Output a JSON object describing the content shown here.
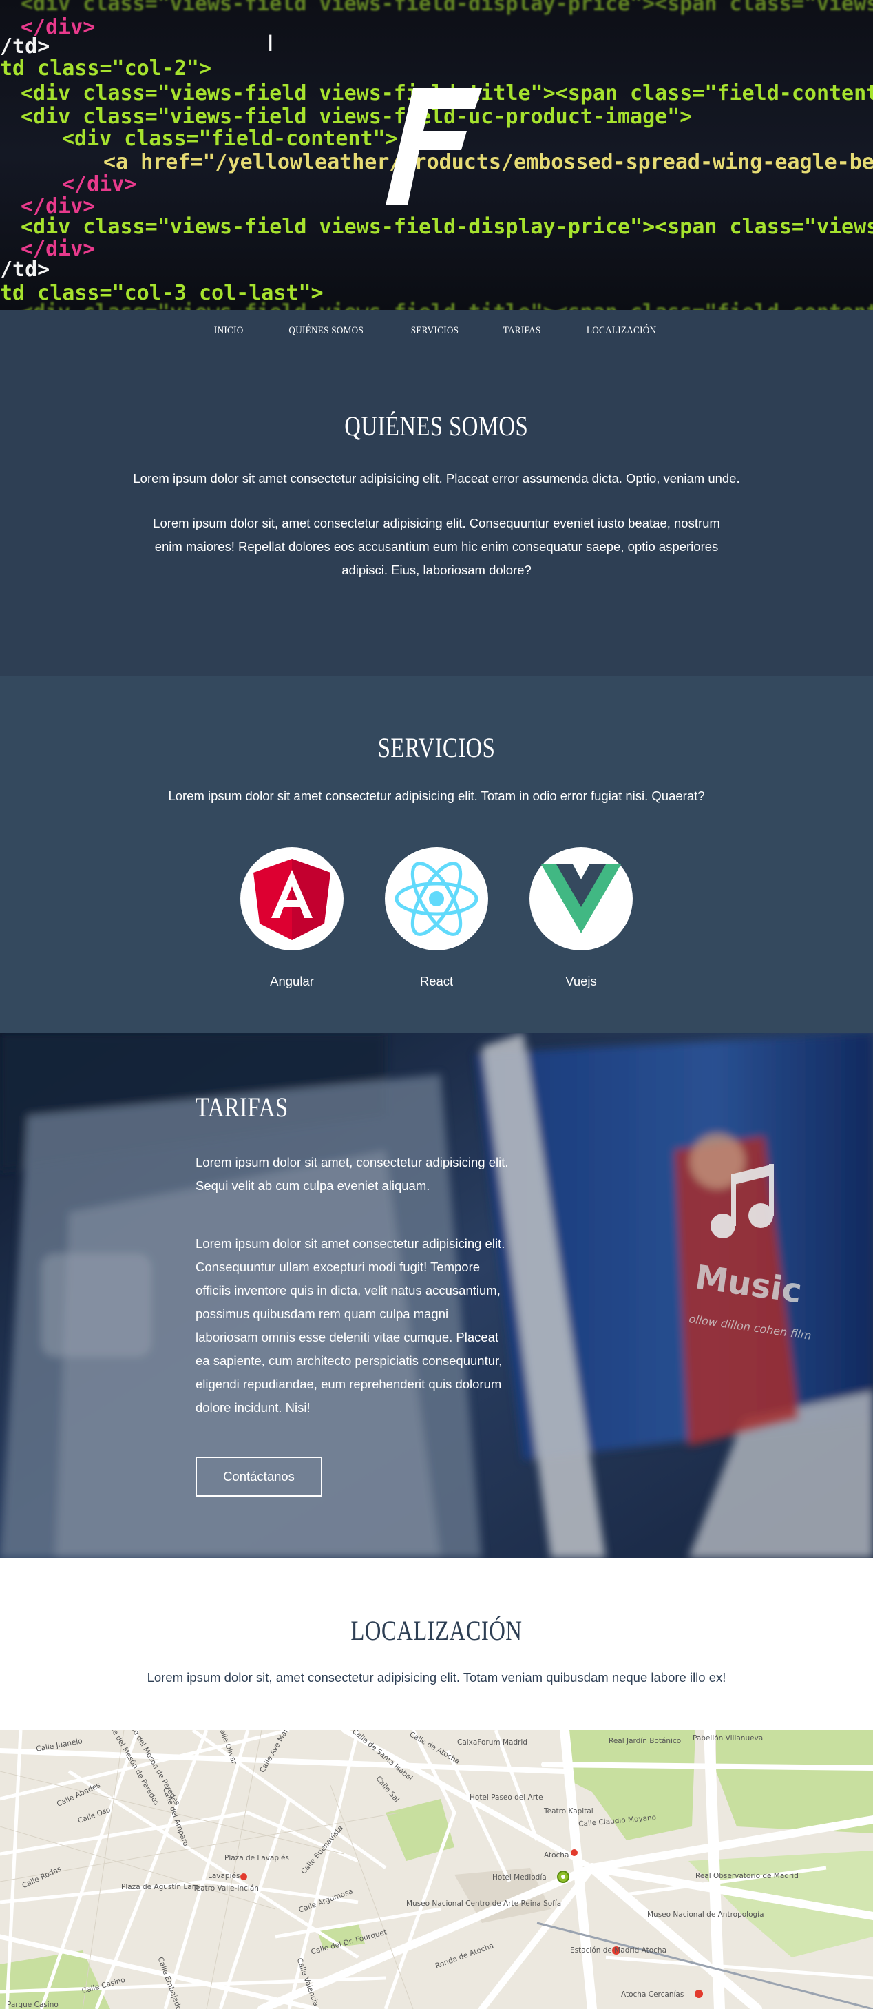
{
  "nav": {
    "items": [
      "INICIO",
      "QUIÉNES SOMOS",
      "SERVICIOS",
      "TARIFAS",
      "LOCALIZACIÓN"
    ]
  },
  "hero": {
    "logo_letter": "F",
    "code_lines": [
      "<div class=\"views-field views-field-display-price\"><span class=\"views-label views-label-display",
      "</div>",
      "/td>",
      "td class=\"col-2\">",
      "<div class=\"views-field views-field-title\"><span class=\"field-content\"><a href=\"/yellowleather/y",
      "<div class=\"views-field views-field-uc-product-image\">",
      "  <div class=\"field-content\">",
      "    <a href=\"/yellowleather/products/embossed-spread-wing-eagle-belt\"><img typeof=\"foaf",
      "  </div>",
      "</div>",
      "<div class=\"views-field views-field-display-price\"><span class=\"views-label views-label-displa",
      "</div>",
      "/td>",
      "td class=\"col-3 col-last\">",
      "<div class=\"views-field views-field-title\"><span class=\"field-content\"><a href=\"/yellowleather/"
    ]
  },
  "about": {
    "title": "QUIÉNES SOMOS",
    "p1": "Lorem ipsum dolor sit amet consectetur adipisicing elit. Placeat error assumenda dicta. Optio, veniam unde.",
    "p2": "Lorem ipsum dolor sit, amet consectetur adipisicing elit. Consequuntur eveniet iusto beatae, nostrum enim maiores! Repellat dolores eos accusantium eum hic enim consequatur saepe, optio asperiores adipisci. Eius, laboriosam dolore?"
  },
  "services": {
    "title": "SERVICIOS",
    "p1": "Lorem ipsum dolor sit amet consectetur adipisicing elit. Totam in odio error fugiat nisi. Quaerat?",
    "items": [
      {
        "label": "Angular",
        "icon": "angular-icon",
        "color": "#dd0031"
      },
      {
        "label": "React",
        "icon": "react-icon",
        "color": "#61dafb"
      },
      {
        "label": "Vuejs",
        "icon": "vue-icon",
        "color": "#41b883"
      }
    ]
  },
  "pricing": {
    "title": "TARIFAS",
    "p1": "Lorem ipsum dolor sit amet, consectetur adipisicing elit. Sequi velit ab cum culpa eveniet aliquam.",
    "p2": "Lorem ipsum dolor sit amet consectetur adipisicing elit. Consequuntur ullam excepturi modi fugit! Tempore officiis inventore quis in dicta, velit natus accusantium, possimus quibusdam rem quam culpa magni laboriosam omnis esse deleniti vitae cumque. Placeat ea sapiente, cum architecto perspiciatis consequuntur, eligendi repudiandae, eum reprehenderit quis dolorum dolore incidunt. Nisi!",
    "button": "Contáctanos",
    "bg_text": [
      "Music",
      "ollow dillon cohen film"
    ]
  },
  "location": {
    "title": "LOCALIZACIÓN",
    "p1": "Lorem ipsum dolor sit, amet consectetur adipisicing elit. Totam veniam quibusdam neque labore illo ex!"
  },
  "map": {
    "labels": [
      "Calle Juanelo",
      "Calle del Mesón de Paredes",
      "Calle Abades",
      "Calle Oso",
      "Calle Rodas",
      "Calle del Amparo",
      "Calle Olivar",
      "Calle Ave María",
      "Plaza de Lavapiés",
      "Lavapiés",
      "Plaza de Agustín Lara",
      "Teatro Valle-Inclán",
      "Calle Buenavista",
      "Calle Argumosa",
      "Calle de Santa Isabel",
      "Calle Sal",
      "Calle de Atocha",
      "CaixaForum Madrid",
      "Hotel Paseo del Arte",
      "Teatro Kapital",
      "Atocha",
      "Hotel Mediodía",
      "Museo Nacional Centro de Arte Reina Sofía",
      "Calle del Dr. Fourquet",
      "Ronda de Atocha",
      "Calle Casino",
      "Parque Casino",
      "Estación de Madrid Atocha",
      "Atocha Cercanías",
      "Real Jardín Botánico",
      "Pabellón Villanueva",
      "Calle Claudio Moyano",
      "Real Observatorio de Madrid",
      "Museo Nacional de Antropología",
      "Calle Valencia",
      "Calle Embajadores",
      "Calle del Meson de Paredes"
    ]
  }
}
